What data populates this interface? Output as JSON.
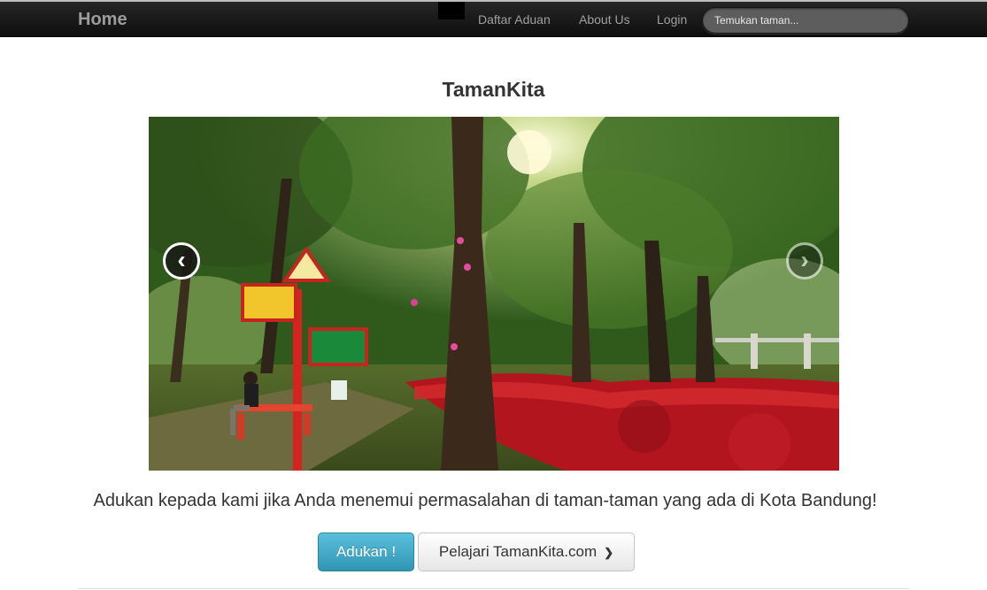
{
  "navbar": {
    "brand": "Home",
    "links": [
      "Daftar Aduan",
      "About Us",
      "Login"
    ],
    "search_placeholder": "Temukan taman..."
  },
  "main": {
    "title": "TamanKita",
    "lead": "Adukan kepada kami jika Anda menemui permasalahan di taman-taman yang ada di Kota Bandung!",
    "primary_button": "Adukan !",
    "secondary_button": "Pelajari TamanKita.com"
  },
  "carousel": {
    "prev_icon": "‹",
    "next_icon": "›"
  },
  "colors": {
    "navbar_bg": "#111111",
    "primary": "#2f96b4",
    "brand_text": "#9c9c9c"
  }
}
